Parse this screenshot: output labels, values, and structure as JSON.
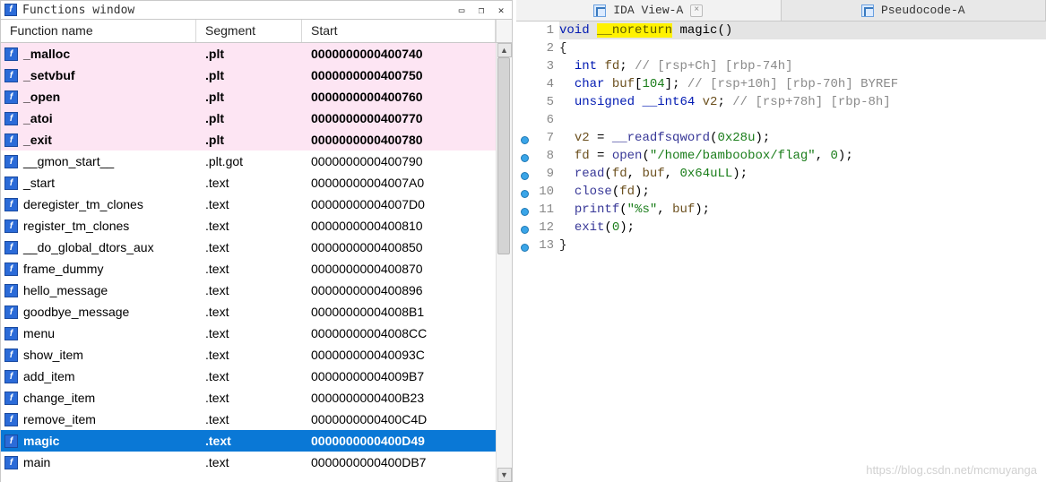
{
  "left": {
    "title": "Functions window",
    "headers": {
      "name": "Function name",
      "segment": "Segment",
      "start": "Start"
    },
    "rows": [
      {
        "name": "_malloc",
        "seg": ".plt",
        "start": "0000000000400740",
        "group": "plt"
      },
      {
        "name": "_setvbuf",
        "seg": ".plt",
        "start": "0000000000400750",
        "group": "plt"
      },
      {
        "name": "_open",
        "seg": ".plt",
        "start": "0000000000400760",
        "group": "plt"
      },
      {
        "name": "_atoi",
        "seg": ".plt",
        "start": "0000000000400770",
        "group": "plt"
      },
      {
        "name": "_exit",
        "seg": ".plt",
        "start": "0000000000400780",
        "group": "plt"
      },
      {
        "name": "__gmon_start__",
        "seg": ".plt.got",
        "start": "0000000000400790",
        "group": "pltgot"
      },
      {
        "name": "_start",
        "seg": ".text",
        "start": "00000000004007A0",
        "group": "text"
      },
      {
        "name": "deregister_tm_clones",
        "seg": ".text",
        "start": "00000000004007D0",
        "group": "text"
      },
      {
        "name": "register_tm_clones",
        "seg": ".text",
        "start": "0000000000400810",
        "group": "text"
      },
      {
        "name": "__do_global_dtors_aux",
        "seg": ".text",
        "start": "0000000000400850",
        "group": "text"
      },
      {
        "name": "frame_dummy",
        "seg": ".text",
        "start": "0000000000400870",
        "group": "text"
      },
      {
        "name": "hello_message",
        "seg": ".text",
        "start": "0000000000400896",
        "group": "text"
      },
      {
        "name": "goodbye_message",
        "seg": ".text",
        "start": "00000000004008B1",
        "group": "text"
      },
      {
        "name": "menu",
        "seg": ".text",
        "start": "00000000004008CC",
        "group": "text"
      },
      {
        "name": "show_item",
        "seg": ".text",
        "start": "000000000040093C",
        "group": "text"
      },
      {
        "name": "add_item",
        "seg": ".text",
        "start": "00000000004009B7",
        "group": "text"
      },
      {
        "name": "change_item",
        "seg": ".text",
        "start": "0000000000400B23",
        "group": "text"
      },
      {
        "name": "remove_item",
        "seg": ".text",
        "start": "0000000000400C4D",
        "group": "text"
      },
      {
        "name": "magic",
        "seg": ".text",
        "start": "0000000000400D49",
        "group": "text",
        "selected": true
      },
      {
        "name": "main",
        "seg": ".text",
        "start": "0000000000400DB7",
        "group": "text",
        "cut": true
      }
    ]
  },
  "tabs": {
    "ida": "IDA View-A",
    "pseudo": "Pseudocode-A"
  },
  "code": {
    "lines": [
      {
        "n": 1,
        "bp": false,
        "tokens": [
          {
            "t": "void ",
            "c": "kw"
          },
          {
            "t": "__noreturn",
            "c": "hi"
          },
          {
            "t": " ",
            "c": ""
          },
          {
            "t": "magic",
            "c": "fn"
          },
          {
            "t": "()",
            "c": ""
          }
        ],
        "bg": true
      },
      {
        "n": 2,
        "bp": false,
        "tokens": [
          {
            "t": "{",
            "c": "brace"
          }
        ]
      },
      {
        "n": 3,
        "bp": false,
        "tokens": [
          {
            "t": "  ",
            "c": ""
          },
          {
            "t": "int",
            "c": "kw"
          },
          {
            "t": " ",
            "c": ""
          },
          {
            "t": "fd",
            "c": "varloc"
          },
          {
            "t": "; ",
            "c": ""
          },
          {
            "t": "// [rsp+Ch] [rbp-74h]",
            "c": "cmt"
          }
        ]
      },
      {
        "n": 4,
        "bp": false,
        "tokens": [
          {
            "t": "  ",
            "c": ""
          },
          {
            "t": "char",
            "c": "kw"
          },
          {
            "t": " ",
            "c": ""
          },
          {
            "t": "buf",
            "c": "varloc"
          },
          {
            "t": "[",
            "c": ""
          },
          {
            "t": "104",
            "c": "num"
          },
          {
            "t": "]; ",
            "c": ""
          },
          {
            "t": "// [rsp+10h] [rbp-70h] BYREF",
            "c": "cmt"
          }
        ]
      },
      {
        "n": 5,
        "bp": false,
        "tokens": [
          {
            "t": "  ",
            "c": ""
          },
          {
            "t": "unsigned",
            "c": "kw"
          },
          {
            "t": " ",
            "c": ""
          },
          {
            "t": "__int64",
            "c": "kw"
          },
          {
            "t": " ",
            "c": ""
          },
          {
            "t": "v2",
            "c": "varloc"
          },
          {
            "t": "; ",
            "c": ""
          },
          {
            "t": "// [rsp+78h] [rbp-8h]",
            "c": "cmt"
          }
        ]
      },
      {
        "n": 6,
        "bp": false,
        "tokens": [
          {
            "t": "",
            "c": ""
          }
        ]
      },
      {
        "n": 7,
        "bp": true,
        "tokens": [
          {
            "t": "  ",
            "c": ""
          },
          {
            "t": "v2",
            "c": "varloc"
          },
          {
            "t": " = ",
            "c": ""
          },
          {
            "t": "__readfsqword",
            "c": "callc"
          },
          {
            "t": "(",
            "c": ""
          },
          {
            "t": "0x28u",
            "c": "numh"
          },
          {
            "t": ");",
            "c": ""
          }
        ]
      },
      {
        "n": 8,
        "bp": true,
        "tokens": [
          {
            "t": "  ",
            "c": ""
          },
          {
            "t": "fd",
            "c": "varloc"
          },
          {
            "t": " = ",
            "c": ""
          },
          {
            "t": "open",
            "c": "callc"
          },
          {
            "t": "(",
            "c": ""
          },
          {
            "t": "\"/home/bamboobox/flag\"",
            "c": "str"
          },
          {
            "t": ", ",
            "c": ""
          },
          {
            "t": "0",
            "c": "num"
          },
          {
            "t": ");",
            "c": ""
          }
        ]
      },
      {
        "n": 9,
        "bp": true,
        "tokens": [
          {
            "t": "  ",
            "c": ""
          },
          {
            "t": "read",
            "c": "callc"
          },
          {
            "t": "(",
            "c": ""
          },
          {
            "t": "fd",
            "c": "varloc"
          },
          {
            "t": ", ",
            "c": ""
          },
          {
            "t": "buf",
            "c": "varloc"
          },
          {
            "t": ", ",
            "c": ""
          },
          {
            "t": "0x64uLL",
            "c": "numh"
          },
          {
            "t": ");",
            "c": ""
          }
        ]
      },
      {
        "n": 10,
        "bp": true,
        "tokens": [
          {
            "t": "  ",
            "c": ""
          },
          {
            "t": "close",
            "c": "callc"
          },
          {
            "t": "(",
            "c": ""
          },
          {
            "t": "fd",
            "c": "varloc"
          },
          {
            "t": ");",
            "c": ""
          }
        ]
      },
      {
        "n": 11,
        "bp": true,
        "tokens": [
          {
            "t": "  ",
            "c": ""
          },
          {
            "t": "printf",
            "c": "callc"
          },
          {
            "t": "(",
            "c": ""
          },
          {
            "t": "\"%s\"",
            "c": "str"
          },
          {
            "t": ", ",
            "c": ""
          },
          {
            "t": "buf",
            "c": "varloc"
          },
          {
            "t": ");",
            "c": ""
          }
        ]
      },
      {
        "n": 12,
        "bp": true,
        "tokens": [
          {
            "t": "  ",
            "c": ""
          },
          {
            "t": "exit",
            "c": "callc"
          },
          {
            "t": "(",
            "c": ""
          },
          {
            "t": "0",
            "c": "num"
          },
          {
            "t": ");",
            "c": ""
          }
        ]
      },
      {
        "n": 13,
        "bp": true,
        "tokens": [
          {
            "t": "}",
            "c": "brace"
          }
        ]
      }
    ]
  },
  "watermark": "https://blog.csdn.net/mcmuyanga"
}
